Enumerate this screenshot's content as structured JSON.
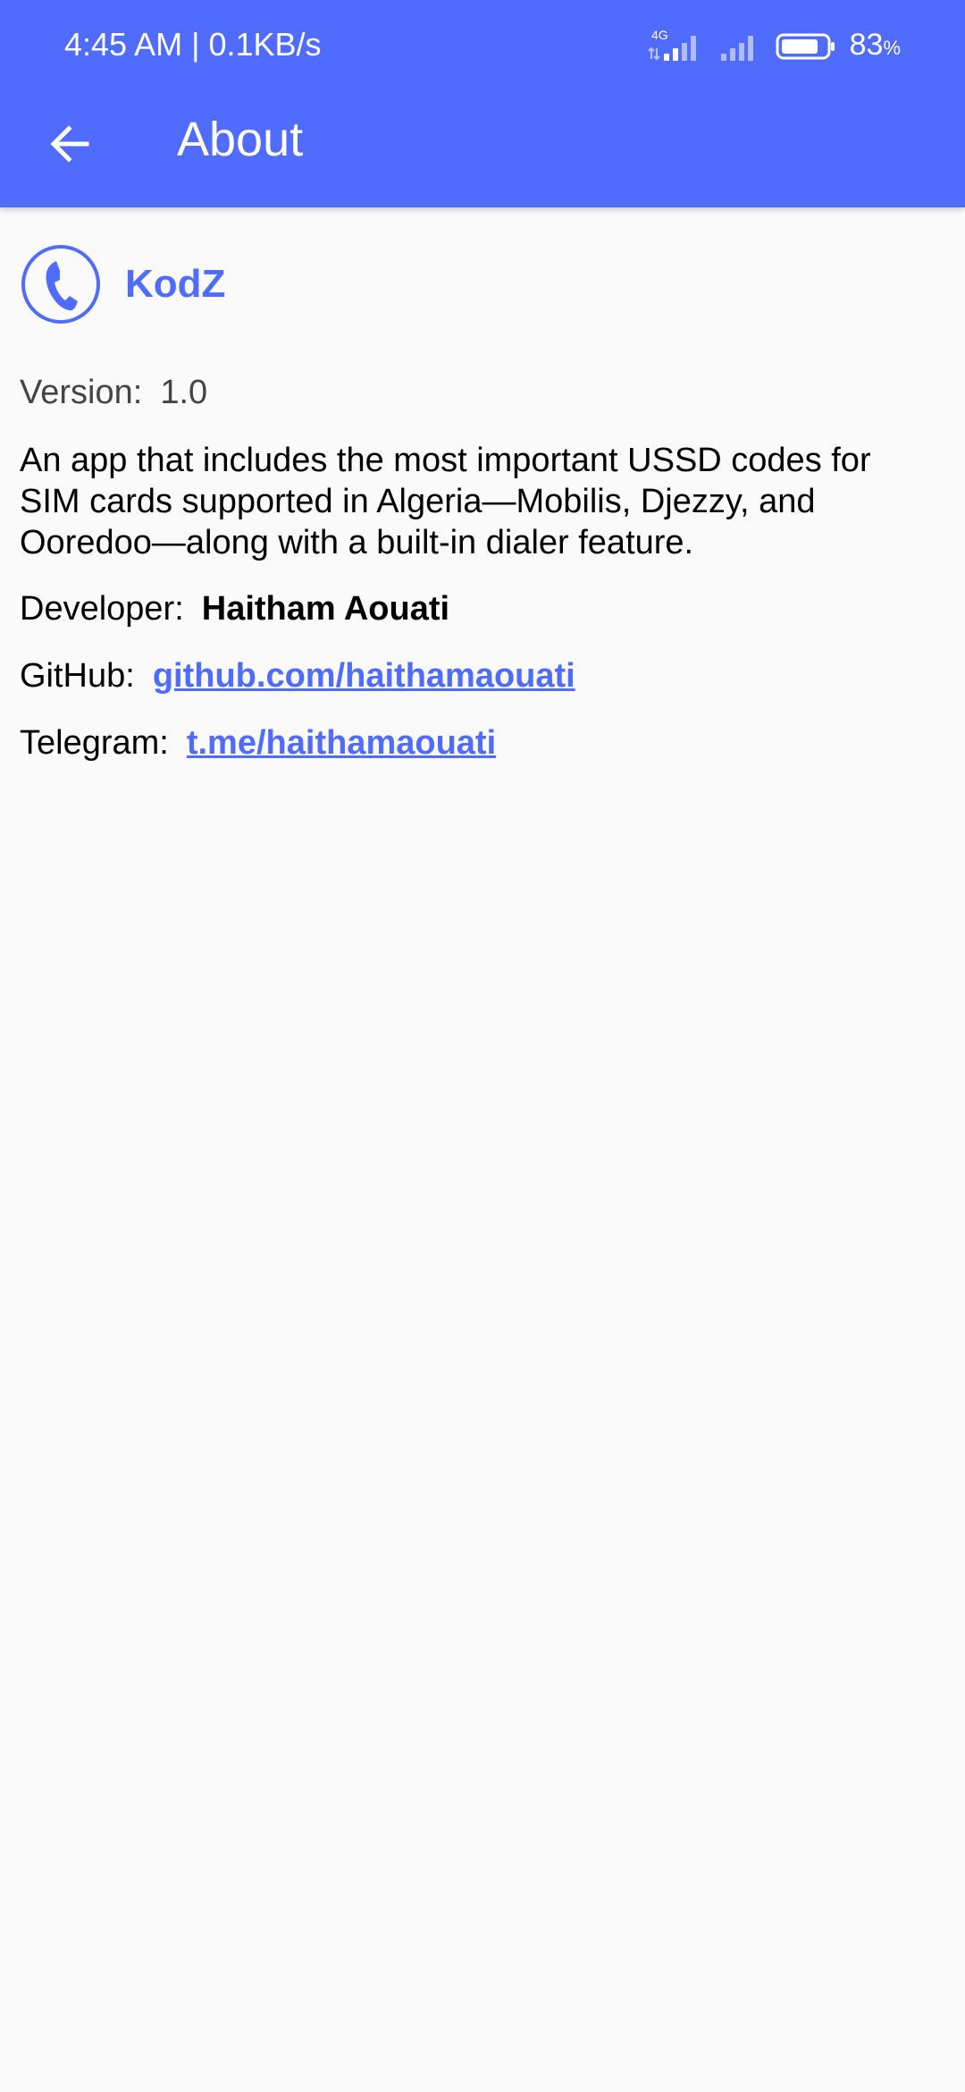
{
  "status_bar": {
    "time_speed": "4:45 AM | 0.1KB/s",
    "network_type": "4G",
    "battery_percent": "83",
    "battery_percent_sign": "%",
    "battery_level": 0.83
  },
  "app_bar": {
    "title": "About",
    "back_icon": "arrow-back-icon"
  },
  "app": {
    "logo_icon": "phone-circle-icon",
    "name": "KodZ"
  },
  "info": {
    "version_label": "Version:",
    "version_value": "1.0",
    "description": "An app that includes the most important USSD codes for SIM cards supported in Algeria—Mobilis, Djezzy, and Ooredoo—along with a built-in dialer feature.",
    "developer_label": "Developer:",
    "developer_value": "Haitham Aouati",
    "github_label": "GitHub:",
    "github_link": "github.com/haithamaouati",
    "telegram_label": "Telegram:",
    "telegram_link": "t.me/haithamaouati"
  },
  "colors": {
    "primary": "#4f6cff",
    "background": "#fafafa",
    "text": "#000000",
    "secondary_text": "#444444"
  }
}
